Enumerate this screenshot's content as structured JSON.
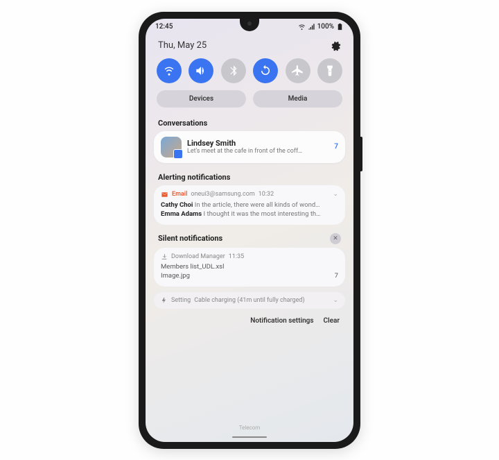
{
  "status": {
    "time": "12:45",
    "battery": "100%"
  },
  "header": {
    "date": "Thu, May 25"
  },
  "pills": {
    "devices": "Devices",
    "media": "Media"
  },
  "sections": {
    "conversations": "Conversations",
    "alerting": "Alerting notifications",
    "silent": "Silent notifications"
  },
  "conversation": {
    "name": "Lindsey Smith",
    "message": "Let's meet at the cafe in front of the coff…",
    "count": "7"
  },
  "email": {
    "app": "Email",
    "address": "oneui3@samsung.com",
    "time": "10:32",
    "items": [
      {
        "sender": "Cathy Choi",
        "text": "In the article, there were all kinds of wond…"
      },
      {
        "sender": "Emma Adams",
        "text": "I thought it was the most interesting th…"
      }
    ]
  },
  "download": {
    "app": "Download Manager",
    "time": "11:35",
    "files": [
      {
        "name": "Members list_UDL.xsl",
        "count": ""
      },
      {
        "name": "Image.jpg",
        "count": "7"
      }
    ]
  },
  "charging": {
    "app": "Setting",
    "text": "Cable charging (41m until fully charged)"
  },
  "footer": {
    "settings": "Notification settings",
    "clear": "Clear"
  },
  "carrier": "Telecom"
}
